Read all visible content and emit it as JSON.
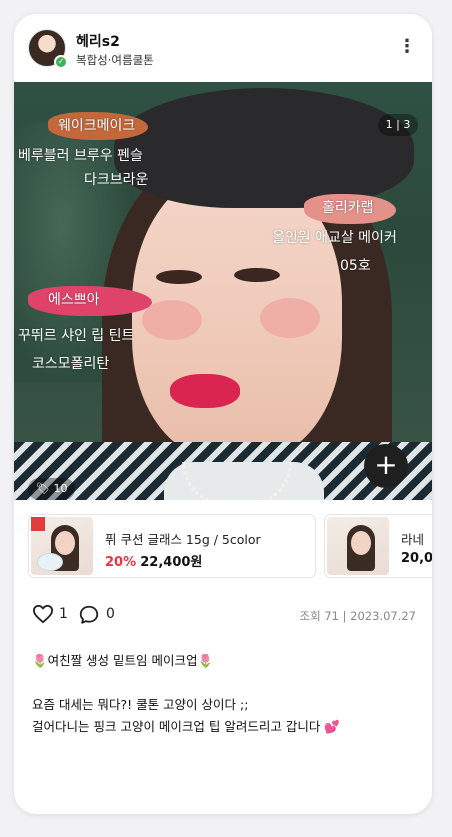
{
  "post": {
    "user": {
      "name": "헤리s2",
      "skin_type": "복합성",
      "separator": "·",
      "personal_color": "여름쿨톤"
    },
    "more_icon": "more-vertical-icon",
    "image": {
      "counter": "1 | 3",
      "tag_count": "10",
      "handwritten": {
        "wakemake_title": "웨이크메이크",
        "wakemake_line1": "베루블러 브루우 펜슬",
        "wakemake_line2": "다크브라운",
        "hollyka_title": "홀리카랩",
        "hollyka_line1": "올인원 애교살 메이커",
        "hollyka_line2": "05호",
        "espoir_title": "에스쁘아",
        "espoir_line1": "꾸뛰르 샤인 립 틴트",
        "espoir_line2": "코스모폴리탄"
      }
    },
    "products": [
      {
        "name": "퓌 쿠션 글래스 15g / 5color",
        "discount": "20%",
        "price": "22,400원"
      },
      {
        "name": "라네",
        "discount": "",
        "price": "20,0"
      }
    ],
    "stats": {
      "likes": "1",
      "comments": "0",
      "views": "조회 71",
      "separator": "|",
      "date": "2023.07.27"
    },
    "caption": {
      "title_emoji_left": "🌷",
      "title": "여친짤 생성 밑트임 메이크업",
      "title_emoji_right": "🌷",
      "line1": "요즘 대세는 뭐다?! 쿨톤 고양이 상이다 ;;",
      "line2": "걸어다니는 핑크 고양이 메이크업 팁 알려드리고 갑니다",
      "line2_emoji": "💕"
    }
  },
  "colors": {
    "accent_discount": "#e8344a",
    "add_button_bg": "#1f1f1f",
    "lip_swatch": "#e0436a",
    "wake_swatch": "#c4683c",
    "holly_swatch": "#e4918a"
  }
}
